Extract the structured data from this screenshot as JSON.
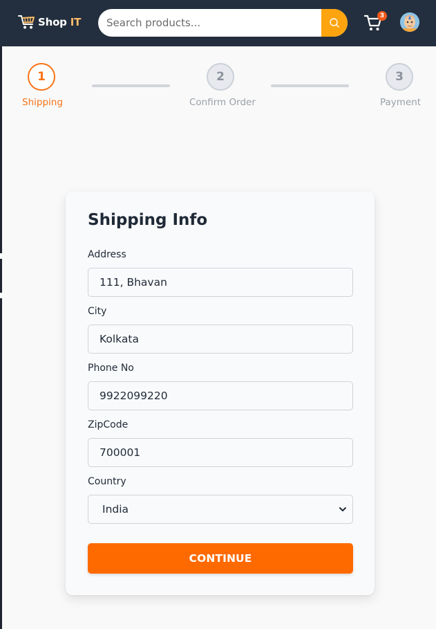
{
  "header": {
    "logo_text_main": "Shop",
    "logo_text_accent": "IT",
    "search": {
      "placeholder": "Search products...",
      "value": ""
    },
    "cart_count": "3",
    "colors": {
      "nav_bg": "#232f3e",
      "accent": "#febd69",
      "search_button": "#fda40f"
    }
  },
  "stepper": {
    "steps": [
      {
        "number": "1",
        "label": "Shipping",
        "state": "active"
      },
      {
        "number": "2",
        "label": "Confirm Order",
        "state": "inactive"
      },
      {
        "number": "3",
        "label": "Payment",
        "state": "inactive"
      }
    ],
    "active_color": "#f97316"
  },
  "form": {
    "title": "Shipping Info",
    "fields": {
      "address": {
        "label": "Address",
        "value": "111, Bhavan"
      },
      "city": {
        "label": "City",
        "value": "Kolkata"
      },
      "phone": {
        "label": "Phone No",
        "value": "9922099220"
      },
      "zipcode": {
        "label": "ZipCode",
        "value": "700001"
      },
      "country": {
        "label": "Country",
        "value": "India"
      }
    },
    "submit_label": "CONTINUE",
    "submit_color": "#ff6a00"
  }
}
